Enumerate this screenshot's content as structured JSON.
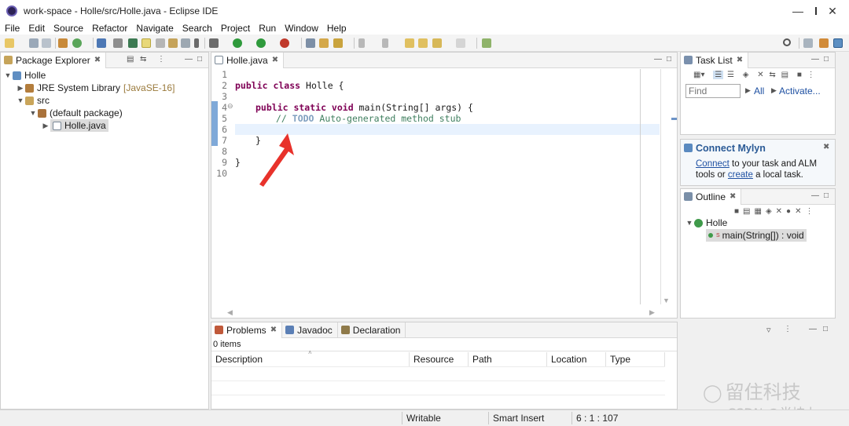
{
  "window": {
    "title": "work-space - Holle/src/Holle.java - Eclipse IDE"
  },
  "menu": [
    "File",
    "Edit",
    "Source",
    "Refactor",
    "Navigate",
    "Search",
    "Project",
    "Run",
    "Window",
    "Help"
  ],
  "package_explorer": {
    "tab": "Package Explorer",
    "tree": {
      "project": "Holle",
      "jre_label": "JRE System Library",
      "jre_version": "[JavaSE-16]",
      "src": "src",
      "default_package": "(default package)",
      "file": "Holle.java"
    }
  },
  "editor": {
    "tab": "Holle.java",
    "line_numbers": [
      "1",
      "2",
      "3",
      "4",
      "5",
      "6",
      "7",
      "8",
      "9",
      "10"
    ],
    "code": {
      "l2_kw": "public class",
      "l2_rest": " Holle {",
      "l4_kw": "public static void",
      "l4_rest": " main(String[] args) {",
      "l5_prefix": "// ",
      "l5_todo": "TODO",
      "l5_rest": " Auto-generated method stub",
      "l7": "}",
      "l9": "}"
    }
  },
  "task_list": {
    "tab": "Task List",
    "find_placeholder": "Find",
    "all_label": "All",
    "activate_label": "Activate..."
  },
  "mylyn": {
    "title": "Connect Mylyn",
    "connect_link": "Connect",
    "text1": " to your task and ALM",
    "text2": "tools or ",
    "create_link": "create",
    "text3": " a local task."
  },
  "outline": {
    "tab": "Outline",
    "class_name": "Holle",
    "method": "main(String[]) : void"
  },
  "bottom": {
    "tabs": [
      "Problems",
      "Javadoc",
      "Declaration"
    ],
    "items_count": "0 items",
    "columns": [
      "Description",
      "Resource",
      "Path",
      "Location",
      "Type"
    ]
  },
  "status": {
    "writable": "Writable",
    "insert_mode": "Smart Insert",
    "position": "6 : 1 : 107"
  },
  "watermark": {
    "brand": "留住科技",
    "csdn": "CSDN @半坡上"
  },
  "colors": {
    "keyword": "#7f0055",
    "comment": "#3f7f5f",
    "arrow": "#e8322b",
    "link": "#1e50a2"
  }
}
